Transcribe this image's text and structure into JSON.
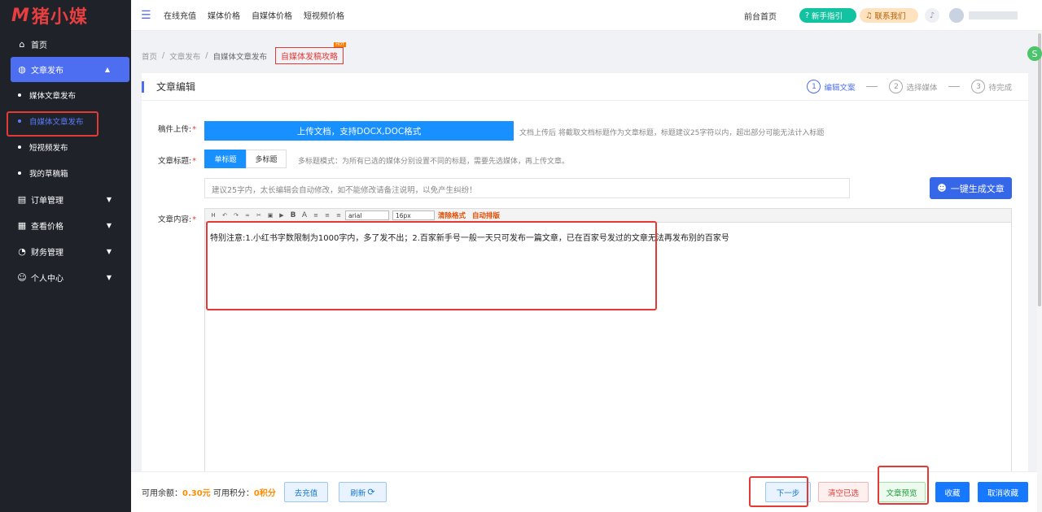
{
  "logo": {
    "mark": "M",
    "text": "猪小媒"
  },
  "sidebar": {
    "items": [
      {
        "label": "首页",
        "icon": "home-icon"
      },
      {
        "label": "文章发布",
        "icon": "globe-icon"
      },
      {
        "label": "订单管理",
        "icon": "order-icon"
      },
      {
        "label": "查看价格",
        "icon": "price-icon"
      },
      {
        "label": "财务管理",
        "icon": "finance-icon"
      },
      {
        "label": "个人中心",
        "icon": "user-icon"
      }
    ],
    "sub": [
      "媒体文章发布",
      "自媒体文章发布",
      "短视频发布",
      "我的草稿箱"
    ]
  },
  "topnav": [
    "在线充值",
    "媒体价格",
    "自媒体价格",
    "短视频价格"
  ],
  "header": {
    "front": "前台首页",
    "guide": "新手指引",
    "contact": "联系我们"
  },
  "breadcrumb": {
    "items": [
      "首页",
      "文章发布",
      "自媒体文章发布"
    ],
    "tag": "自媒体发稿攻略",
    "hot": "HOT"
  },
  "card": {
    "title": "文章编辑"
  },
  "steps": [
    {
      "num": "1",
      "label": "编辑文案"
    },
    {
      "num": "2",
      "label": "选择媒体"
    },
    {
      "num": "3",
      "label": "待完成"
    }
  ],
  "form": {
    "upload_label": "稿件上传:",
    "upload_btn": "上传文档，支持DOCX,DOC格式",
    "upload_hint": "文档上传后 将截取文档标题作为文章标题，标题建议25字符以内，超出部分可能无法计入标题",
    "title_label": "文章标题:",
    "single_tab": "单标题",
    "multi_tab": "多标题",
    "multi_hint": "多标题模式：为所有已选的媒体分别设置不同的标题，需要先选媒体，再上传文章。",
    "title_placeholder": "建议25字内，太长编辑会自动修改，如不能修改请备注说明，以免产生纠纷！",
    "ai_btn": "一键生成文章",
    "content_label": "文章内容:"
  },
  "editor": {
    "font": "arial",
    "size": "16px",
    "clear_fmt": "清除格式",
    "auto_layout": "自动排版",
    "content": "特别注意:1.小红书字数限制为1000字内，多了发不出；2.百家新手号一般一天只可发布一篇文章，已在百家号发过的文章无法再发布别的百家号"
  },
  "footer": {
    "balance_label": "可用余额：",
    "balance": "0.30元",
    "points_label": " 可用积分：",
    "points": "0积分",
    "recharge": "去充值",
    "refresh": "刷新",
    "next": "下一步",
    "clear": "清空已选",
    "preview": "文章预览",
    "collect": "收藏",
    "uncollect": "取消收藏"
  }
}
